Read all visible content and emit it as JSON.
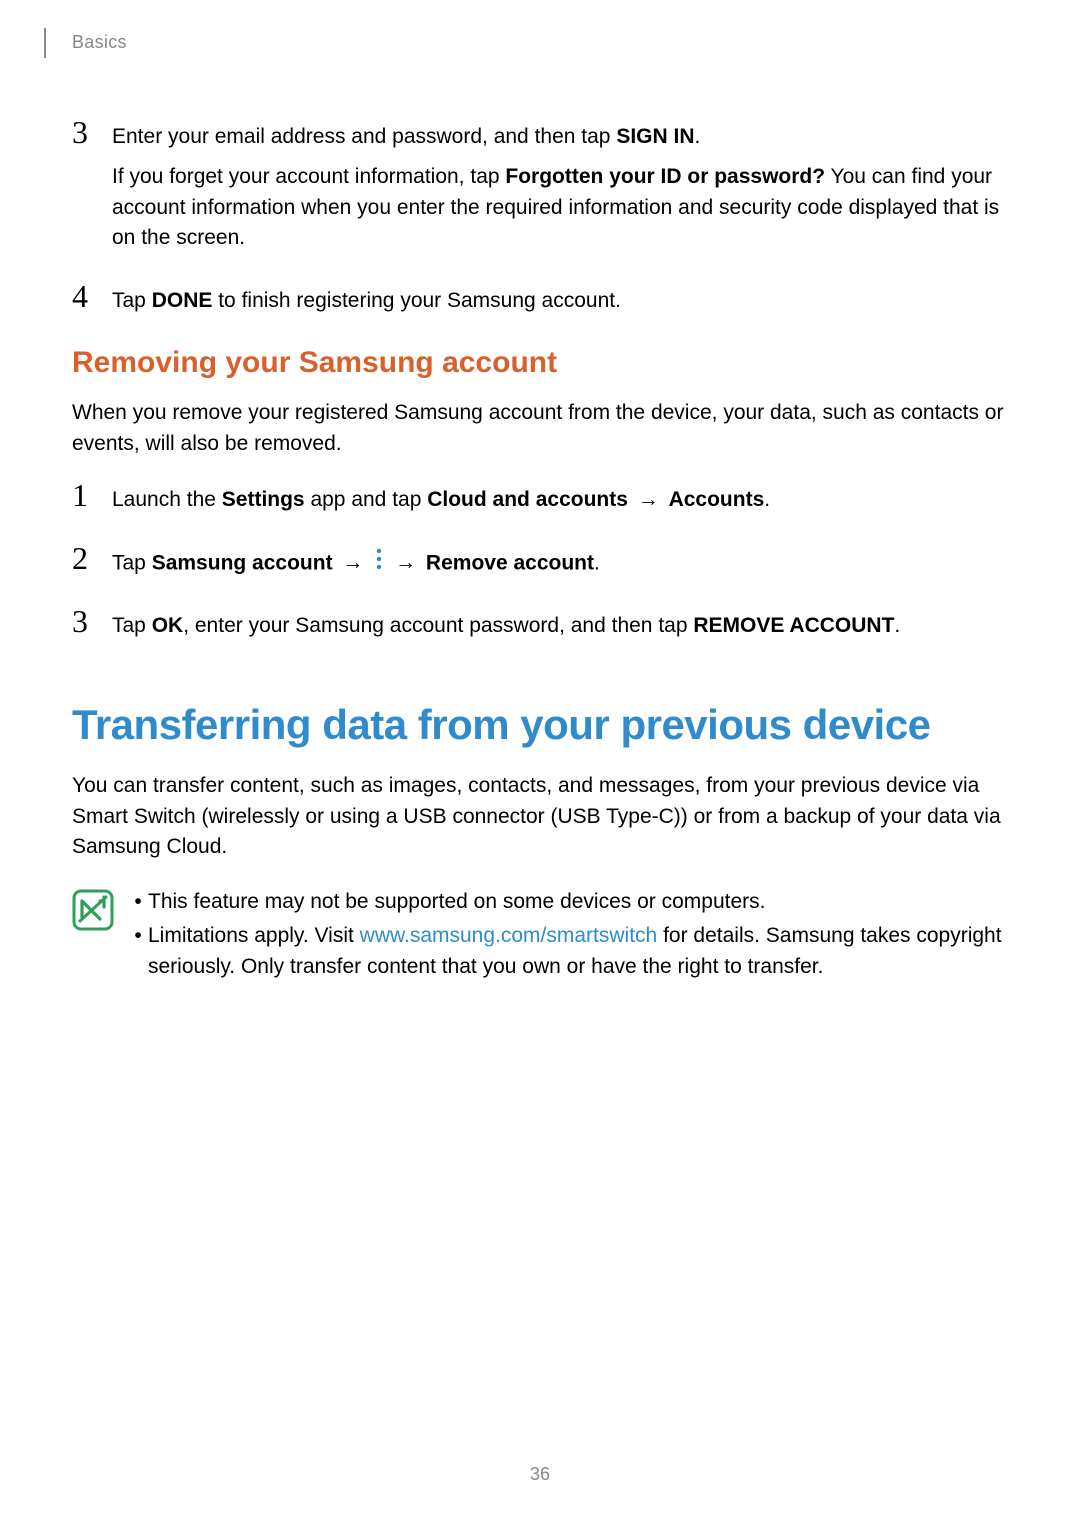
{
  "header": {
    "breadcrumb": "Basics"
  },
  "steps_top": {
    "s3": {
      "num": "3",
      "p1_a": "Enter your email address and password, and then tap ",
      "p1_b": "SIGN IN",
      "p1_c": ".",
      "p2_a": "If you forget your account information, tap ",
      "p2_b": "Forgotten your ID or password?",
      "p2_c": " You can find your account information when you enter the required information and security code displayed that is on the screen."
    },
    "s4": {
      "num": "4",
      "p1_a": "Tap ",
      "p1_b": "DONE",
      "p1_c": " to finish registering your Samsung account."
    }
  },
  "section1": {
    "heading": "Removing your Samsung account",
    "intro": "When you remove your registered Samsung account from the device, your data, such as contacts or events, will also be removed.",
    "s1": {
      "num": "1",
      "a": "Launch the ",
      "b": "Settings",
      "c": " app and tap ",
      "d": "Cloud and accounts",
      "arrow1": " → ",
      "e": "Accounts",
      "f": "."
    },
    "s2": {
      "num": "2",
      "a": "Tap ",
      "b": "Samsung account",
      "arrow1": " → ",
      "arrow2": " → ",
      "c": "Remove account",
      "d": "."
    },
    "s3": {
      "num": "3",
      "a": "Tap ",
      "b": "OK",
      "c": ", enter your Samsung account password, and then tap ",
      "d": "REMOVE ACCOUNT",
      "e": "."
    }
  },
  "section2": {
    "heading": "Transferring data from your previous device",
    "intro": "You can transfer content, such as images, contacts, and messages, from your previous device via Smart Switch (wirelessly or using a USB connector (USB Type-C)) or from a backup of your data via Samsung Cloud.",
    "notes": {
      "n1": "This feature may not be supported on some devices or computers.",
      "n2_a": "Limitations apply. Visit ",
      "n2_link": "www.samsung.com/smartswitch",
      "n2_b": " for details. Samsung takes copyright seriously. Only transfer content that you own or have the right to transfer."
    }
  },
  "page_number": "36"
}
